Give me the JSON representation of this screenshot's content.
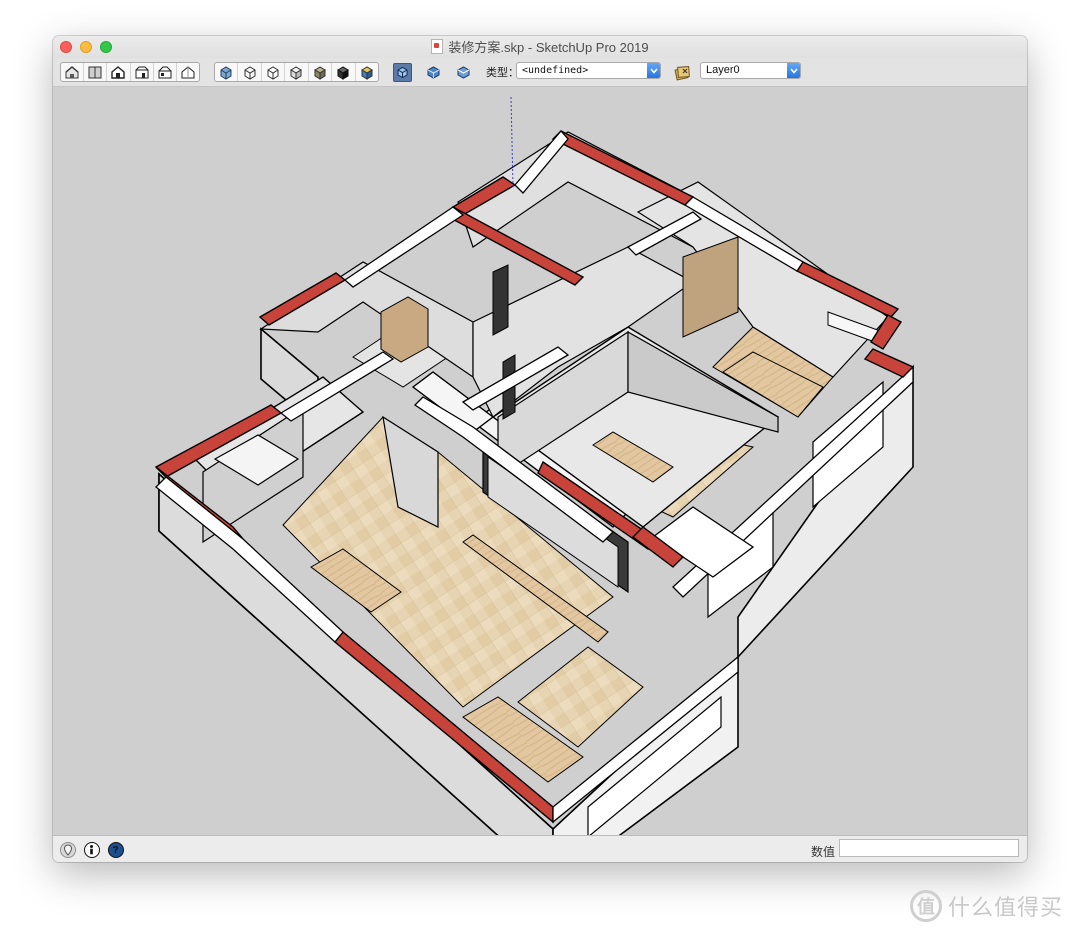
{
  "window": {
    "title": "装修方案.skp - SketchUp Pro 2019",
    "file_icon": "skp-file-icon"
  },
  "toolbar": {
    "view_buttons": [
      "iso-view-icon",
      "top-view-icon",
      "front-view-icon",
      "right-view-icon",
      "back-view-icon",
      "left-view-icon"
    ],
    "style_buttons": [
      "xray-icon",
      "wireframe-icon",
      "hidden-line-icon",
      "shaded-icon",
      "shaded-textures-icon",
      "monochrome-icon",
      "back-edges-icon"
    ],
    "component_buttons": [
      "components-icon",
      "make-component-icon",
      "model-info-icon"
    ],
    "type_label": "类型：",
    "type_value": "<undefined>",
    "layer_manager_icon": "layer-manager-icon",
    "layer_value": "Layer0"
  },
  "viewport": {
    "content": "3d-floor-plan-model",
    "background_color": "#cfcfcf",
    "wall_cut_color": "#c8443b"
  },
  "statusbar": {
    "icons": [
      "geo-location-icon",
      "credits-icon",
      "help-icon"
    ],
    "measurements_label": "数值",
    "measurements_value": ""
  },
  "watermark": {
    "logo_glyph": "值",
    "text": "什么值得买"
  }
}
